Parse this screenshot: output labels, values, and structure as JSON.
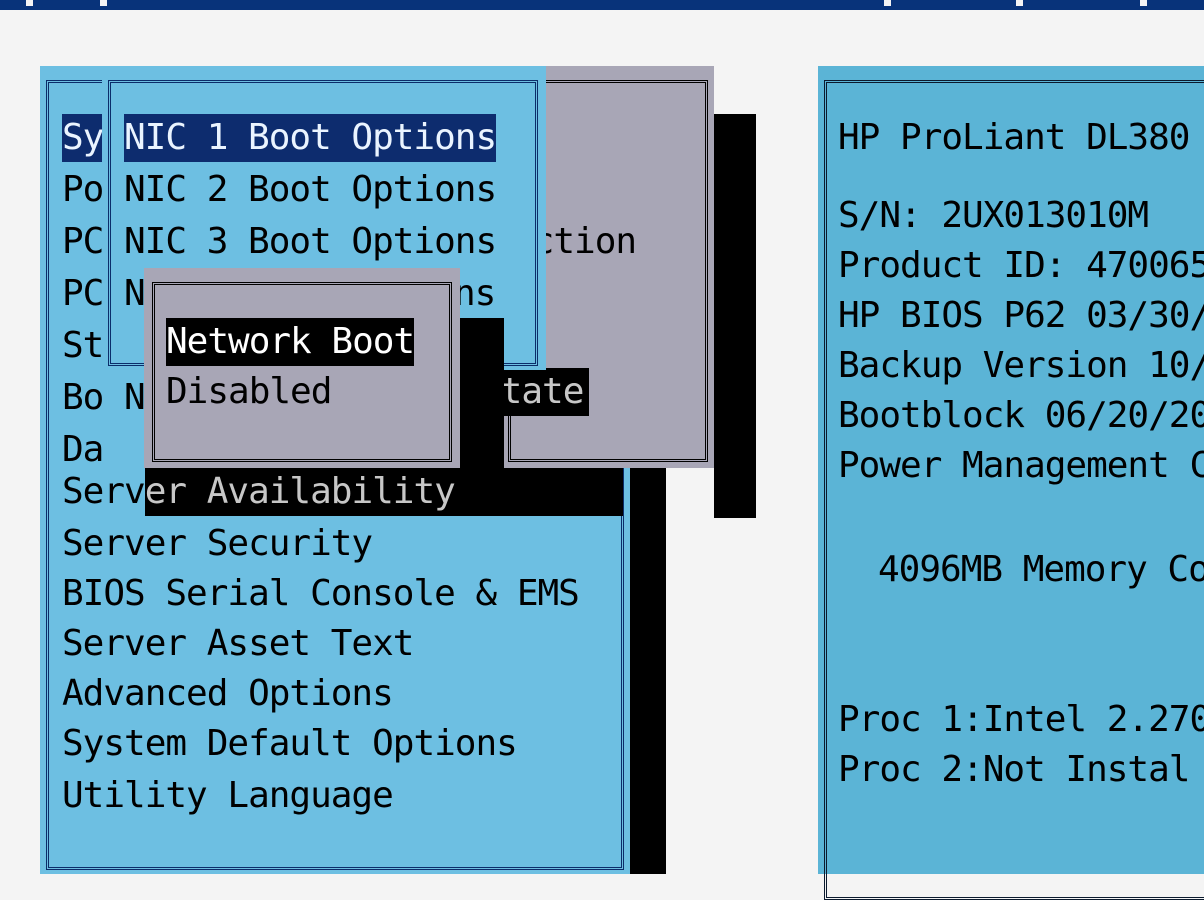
{
  "main_menu": {
    "items": [
      {
        "label": "Sy"
      },
      {
        "label": "Po"
      },
      {
        "label": "PC"
      },
      {
        "label": "PC"
      },
      {
        "label": "St"
      },
      {
        "label": "Bo"
      },
      {
        "label": "Da"
      },
      {
        "label_visible": "Serv",
        "label_covered": "er Availability"
      },
      {
        "label": "Server Security"
      },
      {
        "label": "BIOS Serial Console & EMS"
      },
      {
        "label": "Server Asset Text"
      },
      {
        "label": "Advanced Options"
      },
      {
        "label": "System Default Options"
      },
      {
        "label": "Utility Language"
      }
    ]
  },
  "gray_popup": {
    "fragment_1": "ection",
    "fragment_2": "State"
  },
  "nic_menu": {
    "items": [
      {
        "label": "NIC 1 Boot Options"
      },
      {
        "label": "NIC 2 Boot Options"
      },
      {
        "label": "NIC 3 Boot Options"
      },
      {
        "label_visible": "N",
        "label_tail": "ns"
      }
    ],
    "behind_fragment": "N"
  },
  "network_boot_popup": {
    "options": [
      {
        "label": "Network Boot",
        "selected": true
      },
      {
        "label": "Disabled",
        "selected": false
      }
    ]
  },
  "info_panel": {
    "lines": [
      "HP ProLiant DL380",
      "S/N: 2UX013010M",
      "Product ID: 470065",
      "HP BIOS P62 03/30/",
      "Backup Version 10/",
      "Bootblock 06/20/20",
      "Power Management C",
      "4096MB Memory Co",
      "Proc 1:Intel 2.270",
      "Proc 2:Not Instal"
    ]
  },
  "colors": {
    "menu_bg": "#6dbfe2",
    "info_bg": "#5bb4d6",
    "popup_gray": "#a8a6b6",
    "highlight": "#0d2c6e",
    "title_bar": "#08337a"
  }
}
